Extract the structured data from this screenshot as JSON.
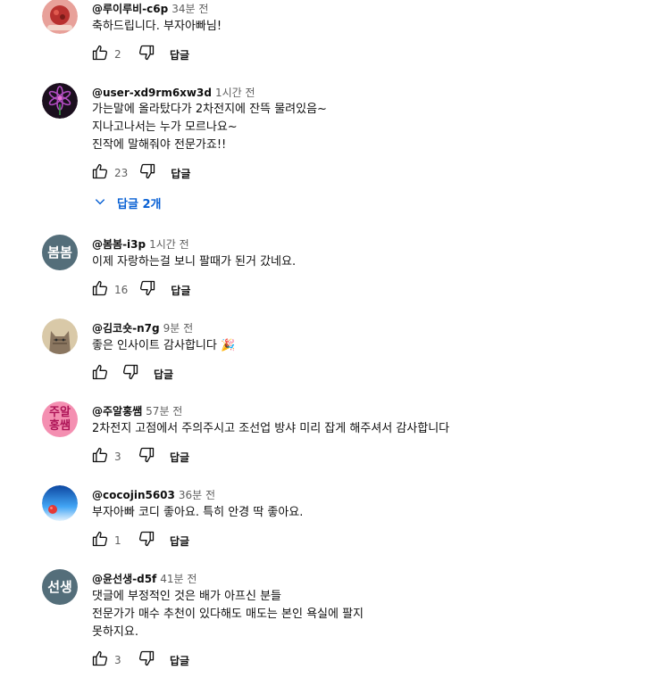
{
  "comments": [
    {
      "handle": "@루이루비-c6p",
      "time": "34분 전",
      "lines": [
        "축하드립니다.  부자아빠님!"
      ],
      "likes": "2",
      "reply_label": "답글",
      "avatar": {
        "type": "image",
        "colors": [
          "#b8312f",
          "#e8a19a"
        ]
      }
    },
    {
      "handle": "@user-xd9rm6xw3d",
      "time": "1시간 전",
      "lines": [
        "가는말에 올라탔다가 2차전지에 잔뜩 물려있음~",
        "지나고나서는 누가 모르나요~",
        "진작에 말해줘야 전문가죠!!"
      ],
      "likes": "23",
      "reply_label": "답글",
      "replies_toggle": "답글 2개",
      "avatar": {
        "type": "image",
        "colors": [
          "#1b0f1e",
          "#9c3a9c"
        ]
      }
    },
    {
      "handle": "@봄봄-i3p",
      "time": "1시간 전",
      "lines": [
        "이제 자랑하는걸 보니 팔때가 된거 갔네요."
      ],
      "likes": "16",
      "reply_label": "답글",
      "avatar": {
        "type": "text",
        "text": "봄봄",
        "bg": "#546e7a"
      }
    },
    {
      "handle": "@김코숏-n7g",
      "time": "9분 전",
      "lines": [
        "좋은 인사이트 감사합니다 🎉"
      ],
      "likes": "",
      "reply_label": "답글",
      "avatar": {
        "type": "image",
        "colors": [
          "#8a7660",
          "#d9c9a8"
        ]
      }
    },
    {
      "handle": "@주알홍쌤",
      "time": "57분 전",
      "lines": [
        "2차전지 고점에서 주의주시고 조선업 방샤 미리 잡게 해주셔서 감사합니다"
      ],
      "likes": "3",
      "reply_label": "답글",
      "avatar": {
        "type": "text",
        "text": "주알홍쌤",
        "line1": "주알",
        "line2": "홍쌤",
        "bg": "#f48fb1",
        "fg": "#ad1457"
      }
    },
    {
      "handle": "@cocojin5603",
      "time": "36분 전",
      "lines": [
        "부자아빠 코디 좋아요. 특히 안경  딱 좋아요."
      ],
      "likes": "1",
      "reply_label": "답글",
      "avatar": {
        "type": "image",
        "colors": [
          "#1565c0",
          "#bbdefb"
        ]
      }
    },
    {
      "handle": "@윤선생-d5f",
      "time": "41분 전",
      "lines": [
        "댓글에 부정적인 것은 배가 아프신 분들",
        "전문가가 매수 추천이 있다해도 매도는 본인 욕실에 팔지",
        "못하지요."
      ],
      "likes": "3",
      "reply_label": "답글",
      "avatar": {
        "type": "text",
        "text": "선생",
        "bg": "#546e7a"
      }
    }
  ]
}
